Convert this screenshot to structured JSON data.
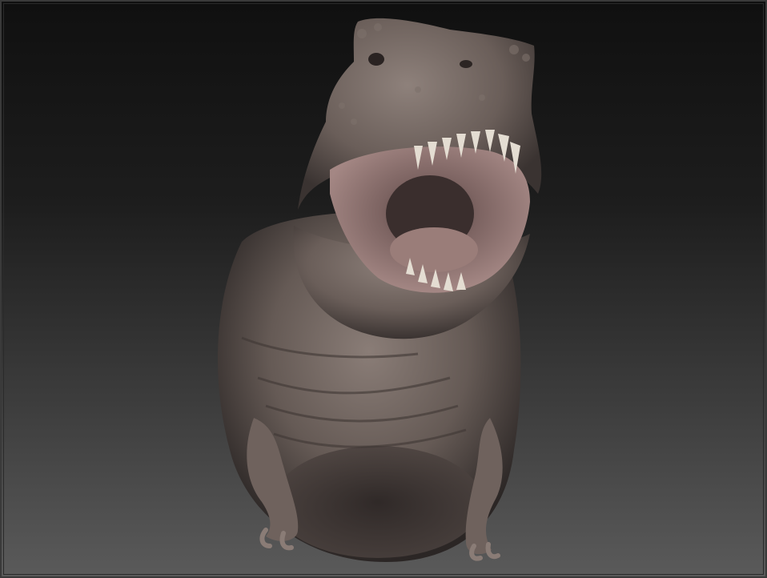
{
  "viewport": {
    "model_name": "",
    "background_top": "#101010",
    "background_bottom": "#5a5a5a",
    "skin_color": "#6e625d",
    "mouth_color": "#8c6f6c",
    "teeth_color": "#e4ddd2"
  }
}
